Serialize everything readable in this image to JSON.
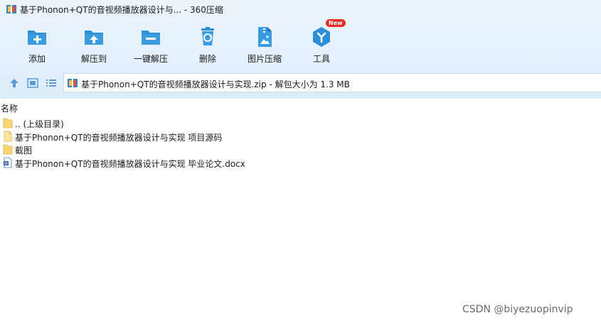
{
  "window": {
    "title": "基于Phonon+QT的音视频播放器设计与... - 360压缩"
  },
  "toolbar": {
    "buttons": [
      {
        "label": "添加",
        "icon": "add-icon"
      },
      {
        "label": "解压到",
        "icon": "extract-to-icon"
      },
      {
        "label": "一键解压",
        "icon": "one-click-extract-icon"
      },
      {
        "label": "删除",
        "icon": "delete-icon"
      },
      {
        "label": "图片压缩",
        "icon": "image-compress-icon"
      },
      {
        "label": "工具",
        "icon": "tools-icon",
        "badge": "New"
      }
    ]
  },
  "address": {
    "text": "基于Phonon+QT的音视频播放器设计与实现.zip - 解包大小为 1.3 MB"
  },
  "file_list": {
    "column_name": "名称",
    "items": [
      {
        "name": ".. (上级目录)",
        "icon": "folder-icon"
      },
      {
        "name": "基于Phonon+QT的音视频播放器设计与实现 项目源码",
        "icon": "file-icon"
      },
      {
        "name": "截图",
        "icon": "folder-icon"
      },
      {
        "name": "基于Phonon+QT的音视频播放器设计与实现 毕业论文.docx",
        "icon": "word-doc-icon"
      }
    ]
  },
  "watermark": "CSDN @biyezuopinvip",
  "colors": {
    "accent_blue": "#2d8fd6",
    "badge_red": "#e52d27",
    "folder_yellow": "#f7d774"
  }
}
